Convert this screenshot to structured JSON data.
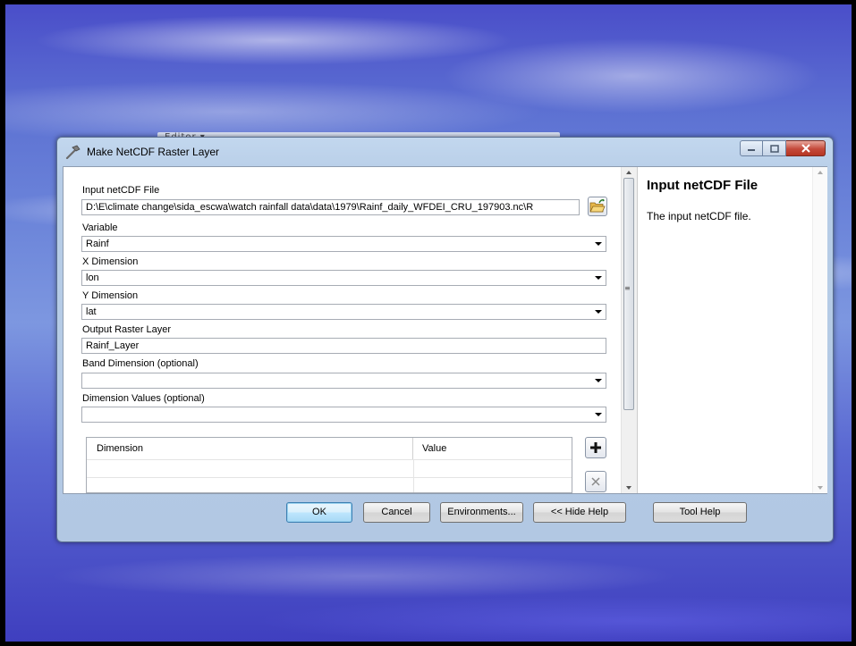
{
  "background_toolbar_text": "Editor ▾",
  "dialog": {
    "title": "Make NetCDF Raster Layer",
    "fields": {
      "input_file": {
        "label": "Input netCDF File",
        "value": "D:\\E\\climate change\\sida_escwa\\watch rainfall data\\data\\1979\\Rainf_daily_WFDEI_CRU_197903.nc\\R"
      },
      "variable": {
        "label": "Variable",
        "value": "Rainf"
      },
      "x_dimension": {
        "label": "X Dimension",
        "value": "lon"
      },
      "y_dimension": {
        "label": "Y Dimension",
        "value": "lat"
      },
      "output_layer": {
        "label": "Output Raster Layer",
        "value": "Rainf_Layer"
      },
      "band_dimension": {
        "label": "Band Dimension (optional)",
        "value": ""
      },
      "dimension_values": {
        "label": "Dimension Values (optional)",
        "value": ""
      }
    },
    "table": {
      "columns": [
        "Dimension",
        "Value"
      ],
      "rows": [
        [
          "",
          ""
        ],
        [
          "",
          ""
        ]
      ]
    },
    "help": {
      "title": "Input netCDF File",
      "text": "The input netCDF file."
    },
    "buttons": {
      "ok": "OK",
      "cancel": "Cancel",
      "environments": "Environments...",
      "hide_help": "<< Hide Help",
      "tool_help": "Tool Help"
    }
  },
  "colors": {
    "slide_blue": "#5a68d2",
    "window_frame": "#b7cde7",
    "close_button": "#c4493a"
  },
  "icons": [
    "hammer-icon",
    "minimize-icon",
    "maximize-icon",
    "close-icon",
    "open-folder-icon",
    "add-icon",
    "remove-icon",
    "dropdown-arrow-icon"
  ]
}
